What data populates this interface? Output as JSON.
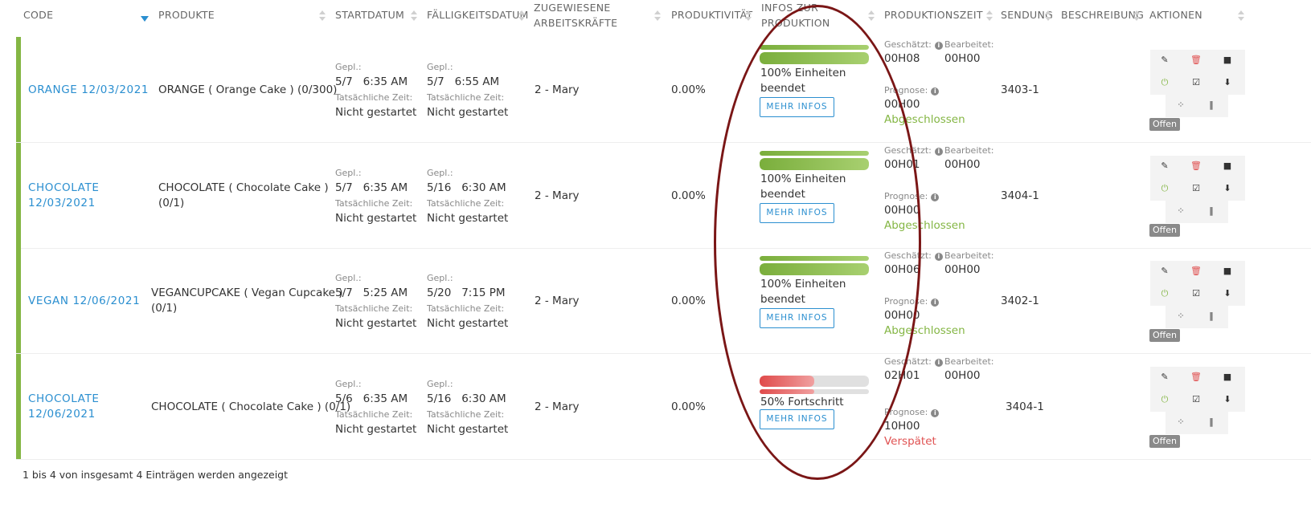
{
  "columns": {
    "code": "CODE",
    "produkte": "PRODUKTE",
    "startdatum": "STARTDATUM",
    "faelligkeitsdatum": "FÄLLIGKEITSDATUM",
    "arbeitskraefte_1": "ZUGEWIESENE",
    "arbeitskraefte_2": "ARBEITSKRÄFTE",
    "produktivitaet": "PRODUKTIVITÄT",
    "infos_1": "INFOS ZUR",
    "infos_2": "PRODUKTION",
    "produktionszeit": "PRODUKTIONSZEIT",
    "sendung": "SENDUNG",
    "beschreibung": "BESCHREIBUNG",
    "aktionen": "AKTIONEN"
  },
  "labels": {
    "gepl": "Gepl.:",
    "tatsaechlich": "Tatsächliche Zeit:",
    "geschaetzt": "Geschätzt:",
    "bearbeitet": "Bearbeitet:",
    "prognose": "Prognose:",
    "mehr_infos": "MEHR INFOS",
    "offen": "Offen"
  },
  "icons": {
    "edit": "edit-icon",
    "delete": "trash-icon",
    "document": "document-icon",
    "power": "power-icon",
    "check": "checkbox-icon",
    "download": "download-icon",
    "hierarchy": "hierarchy-icon",
    "barcode": "barcode-icon",
    "info": "info-icon"
  },
  "colors": {
    "accent": "#2b8fd0",
    "green": "#84b644",
    "red": "#e05252",
    "annotation": "#7a1616"
  },
  "rows": [
    {
      "code_1": "ORANGE 12/03/2021",
      "code_2": "",
      "produkt_1": "ORANGE ( Orange Cake ) (0/300)",
      "produkt_2": "",
      "start_gepl": "5/7   6:35 AM",
      "start_tats": "Nicht gestartet",
      "faellig_gepl": "5/7   6:55 AM",
      "faellig_tats": "Nicht gestartet",
      "arbeitskraefte": "2 - Mary",
      "produktivitaet": "0.00%",
      "progress_1": 1.0,
      "progress_2": 1.0,
      "progress_color": "green",
      "info_1": "100% Einheiten",
      "info_2": "beendet",
      "geschaetzt": "00H08",
      "bearbeitet": "00H00",
      "prognose": "00H00",
      "status": "Abgeschlossen",
      "status_color": "green",
      "sendung": "3403-1"
    },
    {
      "code_1": "CHOCOLATE",
      "code_2": "12/03/2021",
      "produkt_1": "CHOCOLATE ( Chocolate Cake )",
      "produkt_2": "(0/1)",
      "start_gepl": "5/7   6:35 AM",
      "start_tats": "Nicht gestartet",
      "faellig_gepl": "5/16   6:30 AM",
      "faellig_tats": "Nicht gestartet",
      "arbeitskraefte": "2 - Mary",
      "produktivitaet": "0.00%",
      "progress_1": 1.0,
      "progress_2": 1.0,
      "progress_color": "green",
      "info_1": "100% Einheiten",
      "info_2": "beendet",
      "geschaetzt": "00H01",
      "bearbeitet": "00H00",
      "prognose": "00H00",
      "status": "Abgeschlossen",
      "status_color": "green",
      "sendung": "3404-1"
    },
    {
      "code_1": "VEGAN 12/06/2021",
      "code_2": "",
      "produkt_1": "VEGANCUPCAKE ( Vegan Cupcake )",
      "produkt_2": "(0/1)",
      "start_gepl": "5/7   5:25 AM",
      "start_tats": "Nicht gestartet",
      "faellig_gepl": "5/20   7:15 PM",
      "faellig_tats": "Nicht gestartet",
      "arbeitskraefte": "2 - Mary",
      "produktivitaet": "0.00%",
      "progress_1": 1.0,
      "progress_2": 1.0,
      "progress_color": "green",
      "info_1": "100% Einheiten",
      "info_2": "beendet",
      "geschaetzt": "00H06",
      "bearbeitet": "00H00",
      "prognose": "00H00",
      "status": "Abgeschlossen",
      "status_color": "green",
      "sendung": "3402-1"
    },
    {
      "code_1": "CHOCOLATE",
      "code_2": "12/06/2021",
      "produkt_1": "CHOCOLATE ( Chocolate Cake ) (0/1)",
      "produkt_2": "",
      "start_gepl": "5/6   6:35 AM",
      "start_tats": "Nicht gestartet",
      "faellig_gepl": "5/16   6:30 AM",
      "faellig_tats": "Nicht gestartet",
      "arbeitskraefte": "2 - Mary",
      "produktivitaet": "0.00%",
      "progress_1": 0.5,
      "progress_2": 0.5,
      "progress_color": "red",
      "info_1": "50% Fortschritt",
      "info_2": "",
      "geschaetzt": "02H01",
      "bearbeitet": "00H00",
      "prognose": "10H00",
      "status": "Verspätet",
      "status_color": "red",
      "sendung": "3404-1"
    }
  ],
  "footer": "1 bis 4 von insgesamt 4 Einträgen werden angezeigt"
}
